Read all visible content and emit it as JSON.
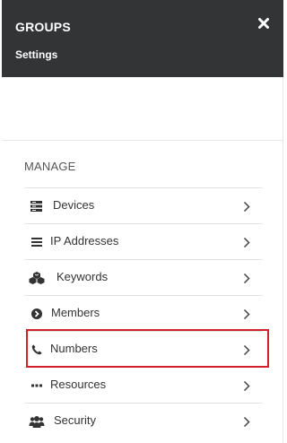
{
  "header": {
    "title": "GROUPS",
    "subtitle": "Settings",
    "close_icon": "close-icon"
  },
  "manage": {
    "section_label": "MANAGE",
    "items": [
      {
        "label": "Devices",
        "icon": "server-icon"
      },
      {
        "label": "IP Addresses",
        "icon": "list-icon"
      },
      {
        "label": "Keywords",
        "icon": "cubes-icon"
      },
      {
        "label": "Members",
        "icon": "arrow-circle-icon"
      },
      {
        "label": "Numbers",
        "icon": "phone-icon"
      },
      {
        "label": "Resources",
        "icon": "ellipsis-icon"
      },
      {
        "label": "Security",
        "icon": "users-icon"
      }
    ]
  },
  "colors": {
    "header_bg": "#323436",
    "highlight": "#d0202a"
  }
}
